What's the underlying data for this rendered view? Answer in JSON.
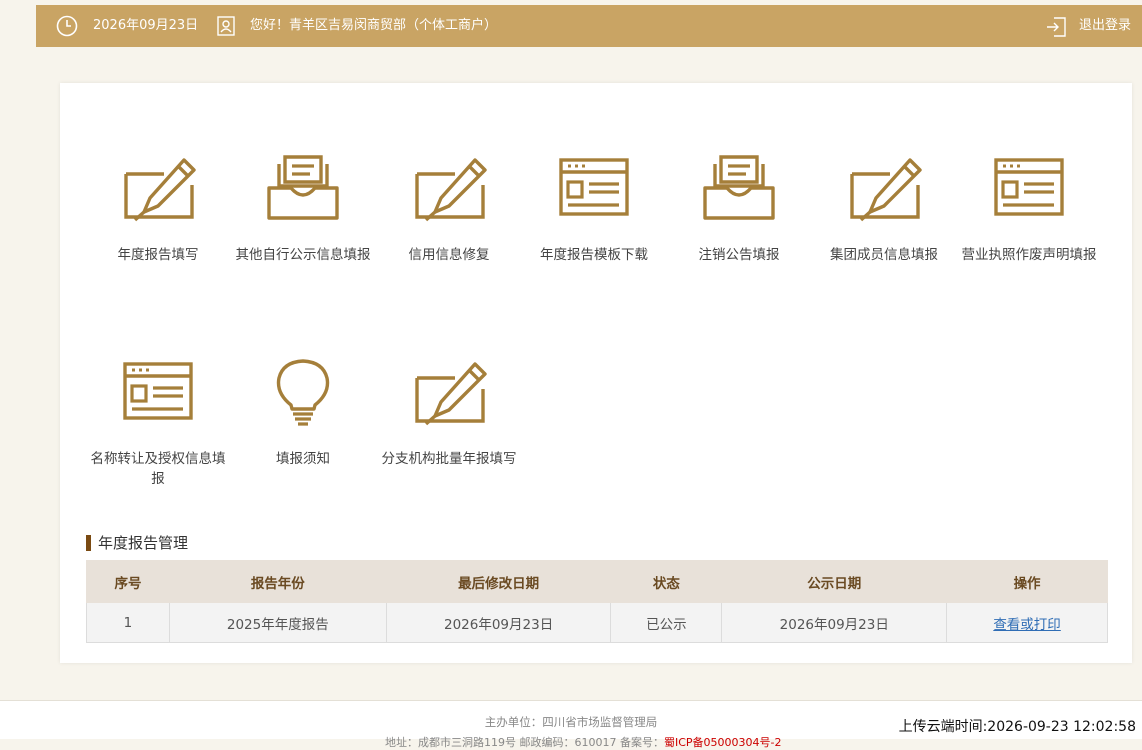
{
  "header": {
    "date": "2026年09月23日",
    "greeting": "您好！青羊区吉易闵商贸部（个体工商户）",
    "logout_label": "退出登录"
  },
  "tiles": [
    {
      "label": "年度报告填写",
      "icon": "edit-icon"
    },
    {
      "label": "其他自行公示信息填报",
      "icon": "inbox-icon"
    },
    {
      "label": "信用信息修复",
      "icon": "edit-icon"
    },
    {
      "label": "年度报告模板下载",
      "icon": "window-icon"
    },
    {
      "label": "注销公告填报",
      "icon": "inbox-icon"
    },
    {
      "label": "集团成员信息填报",
      "icon": "edit-icon"
    },
    {
      "label": "营业执照作废声明填报",
      "icon": "window-icon"
    },
    {
      "label": "名称转让及授权信息填报",
      "icon": "window-icon"
    },
    {
      "label": "填报须知",
      "icon": "lightbulb-icon"
    },
    {
      "label": "分支机构批量年报填写",
      "icon": "edit-icon"
    }
  ],
  "report_section": {
    "title": "年度报告管理",
    "columns": [
      "序号",
      "报告年份",
      "最后修改日期",
      "状态",
      "公示日期",
      "操作"
    ],
    "rows": [
      {
        "index": "1",
        "year": "2025年年度报告",
        "modified": "2026年09月23日",
        "status": "已公示",
        "published": "2026年09月23日",
        "action": "查看或打印"
      }
    ]
  },
  "footer": {
    "host": "主办单位：四川省市场监督管理局",
    "address": "地址：成都市三洞路119号 邮政编码：610017 备案号：",
    "icp": "蜀ICP备05000304号-2"
  },
  "upload_time": "上传云端时间:2026-09-23 12:02:58",
  "colors": {
    "accent": "#c9a464",
    "icon": "#a57f3a",
    "header_text": "#6a4a22",
    "link": "#2f6db5"
  }
}
